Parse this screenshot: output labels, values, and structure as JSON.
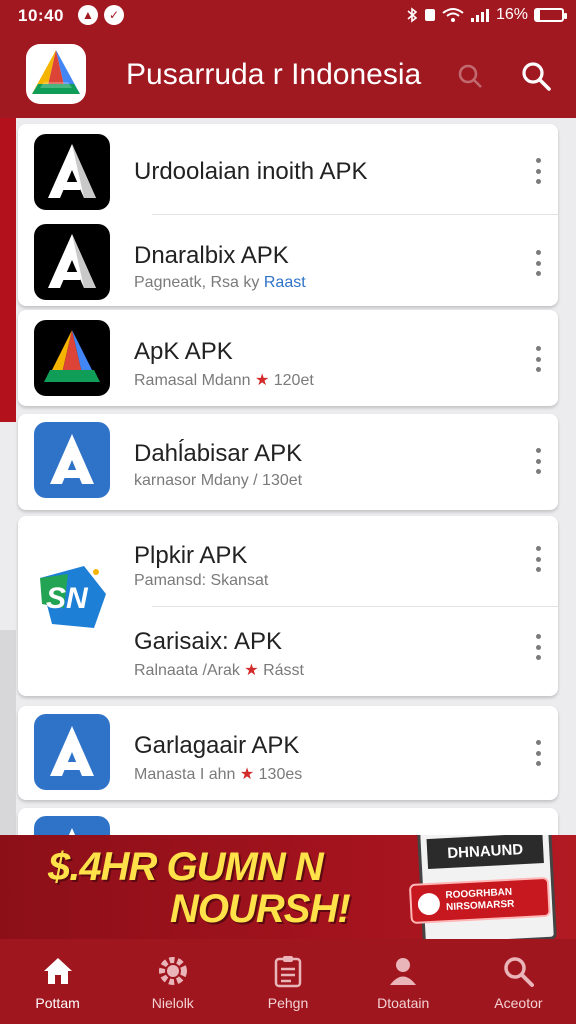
{
  "status_bar": {
    "time": "10:40",
    "battery": "16%",
    "battery_level": 0.16
  },
  "app_bar": {
    "title": "Pusarruda r Indonesia"
  },
  "apps": [
    {
      "title": "Urdoolaian inoith APK",
      "subtitle": ""
    },
    {
      "title": "Dnaralbix APK",
      "subtitle": "Pagneatk, Rsa ky",
      "tag": "Raast"
    },
    {
      "title": "ApK APK",
      "subtitle": "Ramasal Mdann",
      "rating": "120et"
    },
    {
      "title": "Dahĺabisar APK",
      "subtitle": "karnasor Mdany / 130et"
    },
    {
      "title": "Plpkir APK",
      "subtitle": "Pamansd: Skansat"
    },
    {
      "title": "Garisaix: APK",
      "subtitle": "Ralnaata /Arak",
      "rating": "Rásst"
    },
    {
      "title": "Garlagaair APK",
      "subtitle": "Manasta I ahn",
      "rating": "130es"
    }
  ],
  "banner": {
    "line1": "$.4HR GUMN N",
    "line2": "NOURSH!",
    "card_title": "DHNAUND",
    "badge_line1": "ROOGRHBAN",
    "badge_line2": "NIRSOMARSR"
  },
  "bottom_nav": [
    {
      "label": "Pottam",
      "icon": "home-icon"
    },
    {
      "label": "Nielolk",
      "icon": "gear-icon"
    },
    {
      "label": "Pehgn",
      "icon": "clipboard-icon"
    },
    {
      "label": "Dtoatain",
      "icon": "person-icon"
    },
    {
      "label": "Aceotor",
      "icon": "search-icon"
    }
  ],
  "colors": {
    "brand_red": "#a01820",
    "accent_yellow": "#ffe24a",
    "icon_blue": "#2f73c9"
  }
}
